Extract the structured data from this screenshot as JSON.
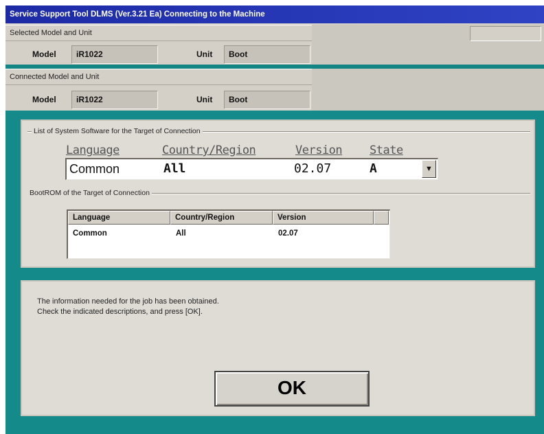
{
  "window": {
    "title": "Service Support Tool DLMS (Ver.3.21 Ea) Connecting to the Machine"
  },
  "selected": {
    "section_label": "Selected Model and Unit",
    "model_label": "Model",
    "model_value": "iR1022",
    "unit_label": "Unit",
    "unit_value": "Boot"
  },
  "connected": {
    "section_label": "Connected Model and Unit",
    "model_label": "Model",
    "model_value": "iR1022",
    "unit_label": "Unit",
    "unit_value": "Boot"
  },
  "system_software": {
    "group_label": "List of System Software for the Target of Connection",
    "headers": {
      "language": "Language",
      "country": "Country/Region",
      "version": "Version",
      "state": "State"
    },
    "selected": {
      "language": "Common",
      "country": "All",
      "version": "02.07",
      "state": "A"
    },
    "dropdown_icon": "dropdown-arrow-icon"
  },
  "bootrom": {
    "group_label": "BootROM of the Target of Connection",
    "columns": [
      "Language",
      "Country/Region",
      "Version"
    ],
    "rows": [
      {
        "language": "Common",
        "country": "All",
        "version": "02.07"
      }
    ]
  },
  "message": {
    "line1": "The information needed for the job has been obtained.",
    "line2": "Check the indicated descriptions, and press [OK]."
  },
  "ok_button": {
    "label": "OK"
  },
  "colors": {
    "title_bar": "#1d2aa6",
    "teal": "#148a8a",
    "panel": "#dfdcd6",
    "window": "#d4d0c8"
  }
}
